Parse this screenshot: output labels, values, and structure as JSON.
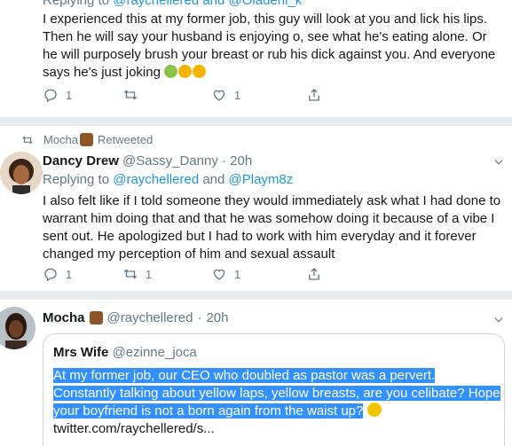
{
  "tweet1": {
    "replying_prefix": "Replying to ",
    "replying_handles": "@raychellered and @Oladeni_k",
    "text": "I experienced this at my former job, this guy will look at you and lick his lips. Then he will say your husband is enjoying o, see what he's eating alone. Or he will purposely brush your breast or rub his dick against you. And everyone says he's just joking",
    "emojis": [
      "nauseated-face-emoji",
      "steam-nose-emoji",
      "steam-nose-emoji"
    ],
    "reply_count": "1",
    "retweet_count": "",
    "like_count": "1"
  },
  "tweet2": {
    "retweeted_by": "Mocha",
    "retweeted_label": "Retweeted",
    "name": "Dancy Drew",
    "handle": "@Sassy_Danny",
    "dot": "·",
    "time": "20h",
    "replying_prefix": "Replying to ",
    "replying_handle_1": "@raychellered",
    "replying_and": " and ",
    "replying_handle_2": "@Playm8z",
    "text": "I also felt like if I told someone they would immediately ask what I had done to warrant him doing that and that he was somehow doing it because of a vibe I sent out. He apologized but I had to work with him everyday and it forever changed my perception of him and sexual assault",
    "reply_count": "1",
    "retweet_count": "1",
    "like_count": "1"
  },
  "tweet3": {
    "name": "Mocha",
    "handle": "@raychellered",
    "dot": "·",
    "time": "20h",
    "quote": {
      "name": "Mrs Wife",
      "handle": "@ezinne_joca",
      "line1": "At my former job, our CEO who doubled as pastor was a pervert.",
      "line2": "Constantly talking about yellow laps, yellow breasts, are you celibate? Hope",
      "line3": "your boyfriend is not a born again from the waist up?",
      "link": "twitter.com/raychellered/s..."
    }
  },
  "colors": {
    "accent": "#1b95e0",
    "text": "#14171a",
    "muted": "#657786",
    "separator": "#e6ecf0",
    "selection": "#3390ff"
  }
}
